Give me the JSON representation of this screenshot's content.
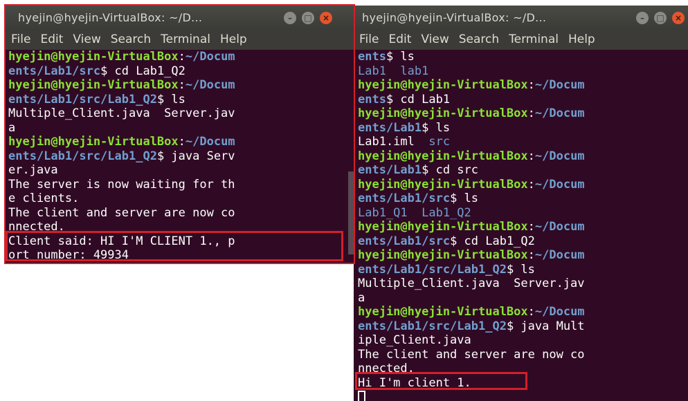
{
  "left_window": {
    "title": "hyejin@hyejin-VirtualBox: ~/D...",
    "menu": [
      "File",
      "Edit",
      "View",
      "Search",
      "Terminal",
      "Help"
    ],
    "lines": [
      {
        "parts": [
          {
            "t": "hyejin@hyejin-VirtualBox",
            "c": "g"
          },
          {
            "t": ":",
            "c": "w"
          },
          {
            "t": "~/Docum",
            "c": "b"
          }
        ]
      },
      {
        "parts": [
          {
            "t": "ents/Lab1/src",
            "c": "b"
          },
          {
            "t": "$ cd Lab1_Q2",
            "c": "w"
          }
        ]
      },
      {
        "parts": [
          {
            "t": "hyejin@hyejin-VirtualBox",
            "c": "g"
          },
          {
            "t": ":",
            "c": "w"
          },
          {
            "t": "~/Docum",
            "c": "b"
          }
        ]
      },
      {
        "parts": [
          {
            "t": "ents/Lab1/src/Lab1_Q2",
            "c": "b"
          },
          {
            "t": "$ ls",
            "c": "w"
          }
        ]
      },
      {
        "parts": [
          {
            "t": "Multiple_Client.java  Server.jav",
            "c": "w"
          }
        ]
      },
      {
        "parts": [
          {
            "t": "a",
            "c": "w"
          }
        ]
      },
      {
        "parts": [
          {
            "t": "hyejin@hyejin-VirtualBox",
            "c": "g"
          },
          {
            "t": ":",
            "c": "w"
          },
          {
            "t": "~/Docum",
            "c": "b"
          }
        ]
      },
      {
        "parts": [
          {
            "t": "ents/Lab1/src/Lab1_Q2",
            "c": "b"
          },
          {
            "t": "$ java Serv",
            "c": "w"
          }
        ]
      },
      {
        "parts": [
          {
            "t": "er.java",
            "c": "w"
          }
        ]
      },
      {
        "parts": [
          {
            "t": "The server is now waiting for th",
            "c": "w"
          }
        ]
      },
      {
        "parts": [
          {
            "t": "e clients.",
            "c": "w"
          }
        ]
      },
      {
        "parts": [
          {
            "t": "The client and server are now co",
            "c": "w"
          }
        ]
      },
      {
        "parts": [
          {
            "t": "nnected.",
            "c": "w"
          }
        ]
      },
      {
        "parts": [
          {
            "t": "Client said: HI I'M CLIENT 1., p",
            "c": "w"
          }
        ]
      },
      {
        "parts": [
          {
            "t": "ort number: 49934",
            "c": "w"
          }
        ]
      }
    ]
  },
  "right_window": {
    "title": "hyejin@hyejin-VirtualBox: ~/D...",
    "menu": [
      "File",
      "Edit",
      "View",
      "Search",
      "Terminal",
      "Help"
    ],
    "lines": [
      {
        "parts": [
          {
            "t": "ents",
            "c": "b"
          },
          {
            "t": "$ ls",
            "c": "w"
          }
        ]
      },
      {
        "parts": [
          {
            "t": "Lab1  lab1",
            "c": "bl"
          }
        ]
      },
      {
        "parts": [
          {
            "t": "hyejin@hyejin-VirtualBox",
            "c": "g"
          },
          {
            "t": ":",
            "c": "w"
          },
          {
            "t": "~/Docum",
            "c": "b"
          }
        ]
      },
      {
        "parts": [
          {
            "t": "ents",
            "c": "b"
          },
          {
            "t": "$ cd Lab1",
            "c": "w"
          }
        ]
      },
      {
        "parts": [
          {
            "t": "hyejin@hyejin-VirtualBox",
            "c": "g"
          },
          {
            "t": ":",
            "c": "w"
          },
          {
            "t": "~/Docum",
            "c": "b"
          }
        ]
      },
      {
        "parts": [
          {
            "t": "ents/Lab1",
            "c": "b"
          },
          {
            "t": "$ ls",
            "c": "w"
          }
        ]
      },
      {
        "parts": [
          {
            "t": "Lab1.iml  ",
            "c": "w"
          },
          {
            "t": "src",
            "c": "bl"
          }
        ]
      },
      {
        "parts": [
          {
            "t": "hyejin@hyejin-VirtualBox",
            "c": "g"
          },
          {
            "t": ":",
            "c": "w"
          },
          {
            "t": "~/Docum",
            "c": "b"
          }
        ]
      },
      {
        "parts": [
          {
            "t": "ents/Lab1",
            "c": "b"
          },
          {
            "t": "$ cd src",
            "c": "w"
          }
        ]
      },
      {
        "parts": [
          {
            "t": "hyejin@hyejin-VirtualBox",
            "c": "g"
          },
          {
            "t": ":",
            "c": "w"
          },
          {
            "t": "~/Docum",
            "c": "b"
          }
        ]
      },
      {
        "parts": [
          {
            "t": "ents/Lab1/src",
            "c": "b"
          },
          {
            "t": "$ ls",
            "c": "w"
          }
        ]
      },
      {
        "parts": [
          {
            "t": "Lab1_Q1  Lab1_Q2",
            "c": "bl"
          }
        ]
      },
      {
        "parts": [
          {
            "t": "hyejin@hyejin-VirtualBox",
            "c": "g"
          },
          {
            "t": ":",
            "c": "w"
          },
          {
            "t": "~/Docum",
            "c": "b"
          }
        ]
      },
      {
        "parts": [
          {
            "t": "ents/Lab1/src",
            "c": "b"
          },
          {
            "t": "$ cd Lab1_Q2",
            "c": "w"
          }
        ]
      },
      {
        "parts": [
          {
            "t": "hyejin@hyejin-VirtualBox",
            "c": "g"
          },
          {
            "t": ":",
            "c": "w"
          },
          {
            "t": "~/Docum",
            "c": "b"
          }
        ]
      },
      {
        "parts": [
          {
            "t": "ents/Lab1/src/Lab1_Q2",
            "c": "b"
          },
          {
            "t": "$ ls",
            "c": "w"
          }
        ]
      },
      {
        "parts": [
          {
            "t": "Multiple_Client.java  Server.jav",
            "c": "w"
          }
        ]
      },
      {
        "parts": [
          {
            "t": "a",
            "c": "w"
          }
        ]
      },
      {
        "parts": [
          {
            "t": "hyejin@hyejin-VirtualBox",
            "c": "g"
          },
          {
            "t": ":",
            "c": "w"
          },
          {
            "t": "~/Docum",
            "c": "b"
          }
        ]
      },
      {
        "parts": [
          {
            "t": "ents/Lab1/src/Lab1_Q2",
            "c": "b"
          },
          {
            "t": "$ java Mult",
            "c": "w"
          }
        ]
      },
      {
        "parts": [
          {
            "t": "iple_Client.java",
            "c": "w"
          }
        ]
      },
      {
        "parts": [
          {
            "t": "The client and server are now co",
            "c": "w"
          }
        ]
      },
      {
        "parts": [
          {
            "t": "nnected.",
            "c": "w"
          }
        ]
      },
      {
        "parts": [
          {
            "t": "Hi I'm client 1.",
            "c": "w"
          }
        ]
      }
    ]
  },
  "colors": {
    "terminal_bg": "#300a24",
    "prompt_user": "#8ae234",
    "prompt_path": "#729fcf",
    "highlight_box": "#d2202a"
  }
}
